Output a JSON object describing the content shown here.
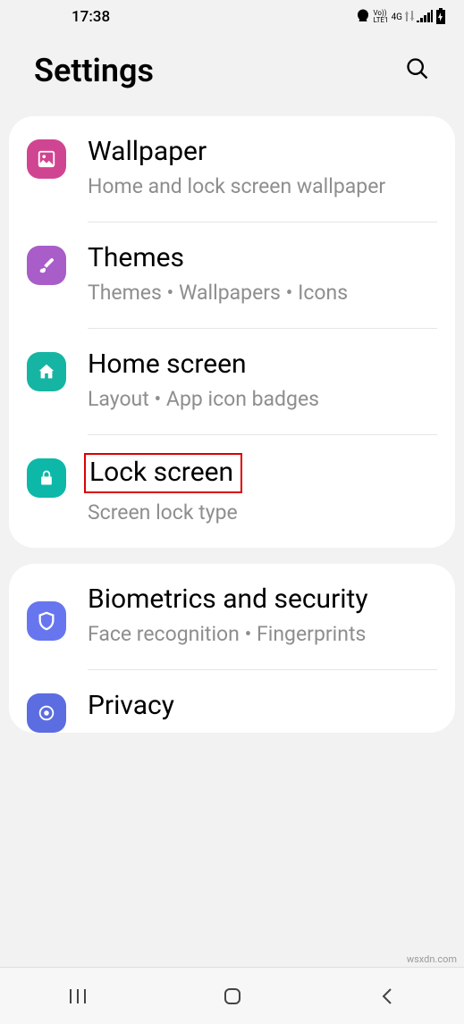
{
  "status": {
    "time": "17:38",
    "volte": "Vo))\nLTE1",
    "net": "4G"
  },
  "header": {
    "title": "Settings"
  },
  "groups": [
    {
      "items": [
        {
          "id": "wallpaper",
          "icon": "picture-icon",
          "iconClass": "ic-pink",
          "title": "Wallpaper",
          "subtitle": "Home and lock screen wallpaper",
          "highlighted": false
        },
        {
          "id": "themes",
          "icon": "brush-icon",
          "iconClass": "ic-purple",
          "title": "Themes",
          "subtitle": "Themes  •  Wallpapers  •  Icons",
          "highlighted": false
        },
        {
          "id": "home-screen",
          "icon": "home-icon",
          "iconClass": "ic-teal1",
          "title": "Home screen",
          "subtitle": "Layout  •  App icon badges",
          "highlighted": false
        },
        {
          "id": "lock-screen",
          "icon": "lock-icon",
          "iconClass": "ic-teal2",
          "title": "Lock screen",
          "subtitle": "Screen lock type",
          "highlighted": true
        }
      ]
    },
    {
      "items": [
        {
          "id": "biometrics",
          "icon": "shield-icon",
          "iconClass": "ic-blue",
          "title": "Biometrics and security",
          "subtitle": "Face recognition  •  Fingerprints",
          "highlighted": false
        },
        {
          "id": "privacy",
          "icon": "privacy-icon",
          "iconClass": "ic-blue2",
          "title": "Privacy",
          "subtitle": "",
          "highlighted": false
        }
      ]
    }
  ],
  "watermark": "wsxdn.com"
}
